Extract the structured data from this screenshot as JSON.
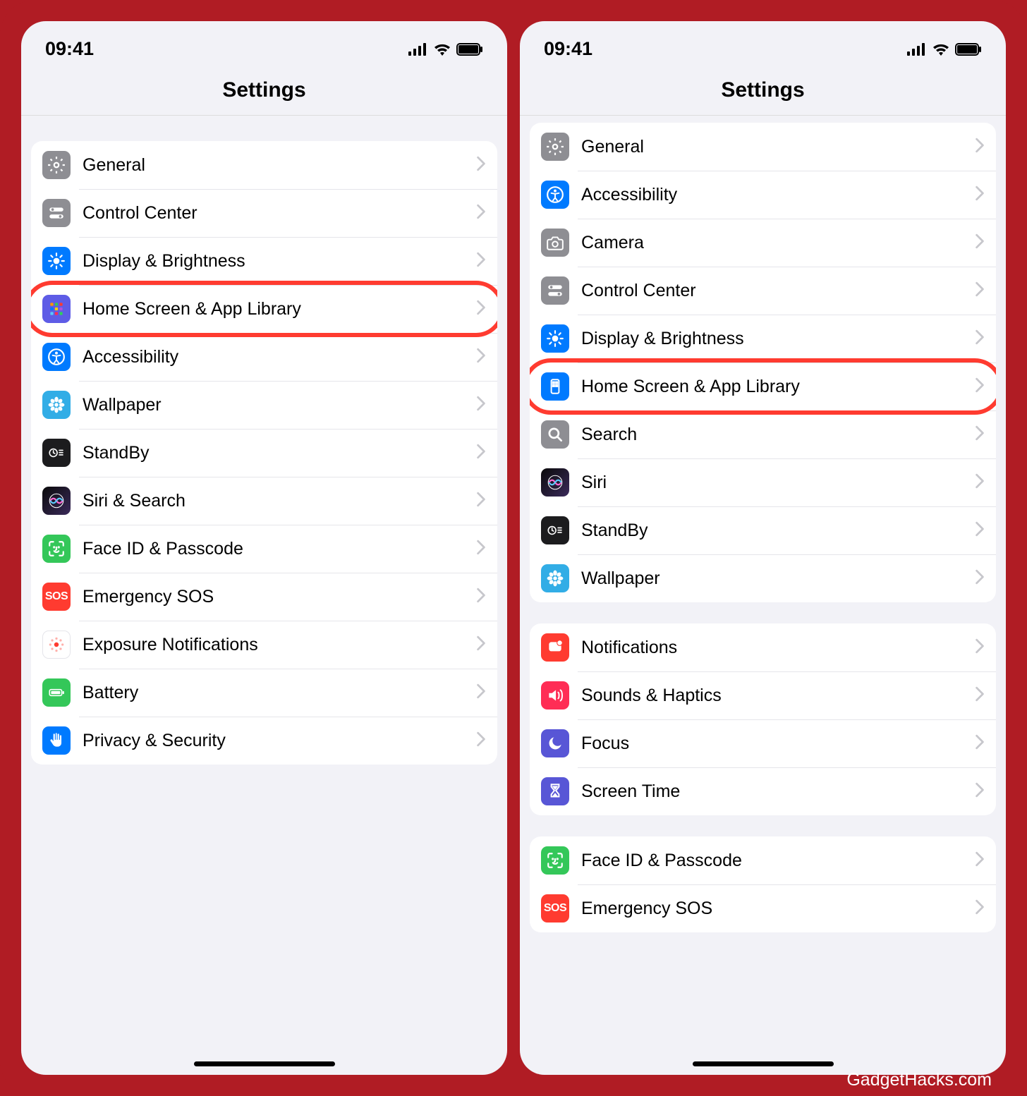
{
  "attribution": "GadgetHacks.com",
  "phoneLeft": {
    "time": "09:41",
    "headerTitle": "Settings",
    "rows": [
      {
        "label": "General",
        "icon": "gear-icon",
        "bg": "bg-gray",
        "highlighted": false
      },
      {
        "label": "Control Center",
        "icon": "switches-icon",
        "bg": "bg-gray",
        "highlighted": false
      },
      {
        "label": "Display & Brightness",
        "icon": "brightness-icon",
        "bg": "bg-blue",
        "highlighted": false
      },
      {
        "label": "Home Screen & App Library",
        "icon": "grid-icon",
        "bg": "bg-indigo",
        "highlighted": true
      },
      {
        "label": "Accessibility",
        "icon": "accessibility-icon",
        "bg": "bg-blue",
        "highlighted": false
      },
      {
        "label": "Wallpaper",
        "icon": "flower-icon",
        "bg": "bg-cyan",
        "highlighted": false
      },
      {
        "label": "StandBy",
        "icon": "clock-icon",
        "bg": "bg-black",
        "highlighted": false
      },
      {
        "label": "Siri & Search",
        "icon": "siri-icon",
        "bg": "bg-gradient",
        "highlighted": false
      },
      {
        "label": "Face ID & Passcode",
        "icon": "faceid-icon",
        "bg": "bg-green",
        "highlighted": false
      },
      {
        "label": "Emergency SOS",
        "icon": "sos-icon",
        "bg": "bg-red",
        "highlighted": false
      },
      {
        "label": "Exposure Notifications",
        "icon": "exposure-icon",
        "bg": "bg-white",
        "highlighted": false
      },
      {
        "label": "Battery",
        "icon": "battery-icon",
        "bg": "bg-green",
        "highlighted": false
      },
      {
        "label": "Privacy & Security",
        "icon": "hand-icon",
        "bg": "bg-blue",
        "highlighted": false
      }
    ]
  },
  "phoneRight": {
    "time": "09:41",
    "headerTitle": "Settings",
    "groups": [
      {
        "rows": [
          {
            "label": "General",
            "icon": "gear-icon",
            "bg": "bg-gray",
            "highlighted": false
          },
          {
            "label": "Accessibility",
            "icon": "accessibility-icon",
            "bg": "bg-blue",
            "highlighted": false
          },
          {
            "label": "Camera",
            "icon": "camera-icon",
            "bg": "bg-gray",
            "highlighted": false
          },
          {
            "label": "Control Center",
            "icon": "switches-icon",
            "bg": "bg-gray",
            "highlighted": false
          },
          {
            "label": "Display & Brightness",
            "icon": "brightness-icon",
            "bg": "bg-blue",
            "highlighted": false
          },
          {
            "label": "Home Screen & App Library",
            "icon": "phone-icon",
            "bg": "bg-blue",
            "highlighted": true
          },
          {
            "label": "Search",
            "icon": "search-icon",
            "bg": "bg-gray",
            "highlighted": false
          },
          {
            "label": "Siri",
            "icon": "siri-icon",
            "bg": "bg-gradient",
            "highlighted": false
          },
          {
            "label": "StandBy",
            "icon": "clock-icon",
            "bg": "bg-black",
            "highlighted": false
          },
          {
            "label": "Wallpaper",
            "icon": "flower-icon",
            "bg": "bg-cyan",
            "highlighted": false
          }
        ]
      },
      {
        "rows": [
          {
            "label": "Notifications",
            "icon": "bell-icon",
            "bg": "bg-red",
            "highlighted": false
          },
          {
            "label": "Sounds & Haptics",
            "icon": "speaker-icon",
            "bg": "bg-pink",
            "highlighted": false
          },
          {
            "label": "Focus",
            "icon": "moon-icon",
            "bg": "bg-purple",
            "highlighted": false
          },
          {
            "label": "Screen Time",
            "icon": "hourglass-icon",
            "bg": "bg-purple",
            "highlighted": false
          }
        ]
      },
      {
        "rows": [
          {
            "label": "Face ID & Passcode",
            "icon": "faceid-icon",
            "bg": "bg-green",
            "highlighted": false
          },
          {
            "label": "Emergency SOS",
            "icon": "sos-icon",
            "bg": "bg-red",
            "highlighted": false
          }
        ]
      }
    ]
  }
}
